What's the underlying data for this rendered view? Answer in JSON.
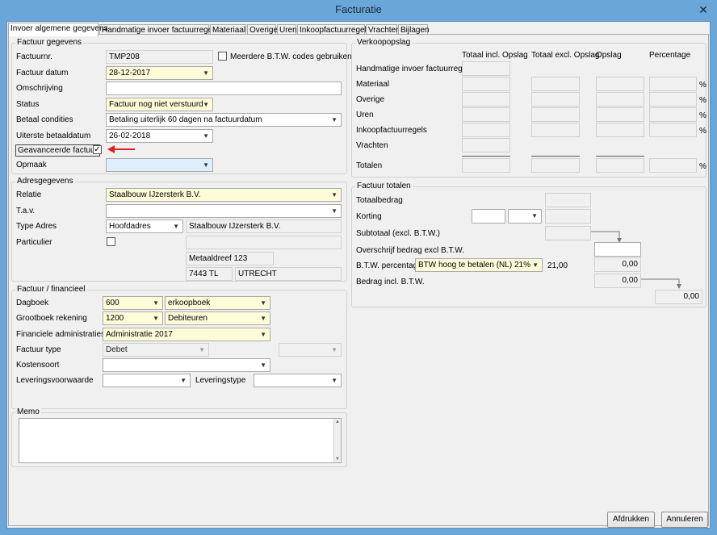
{
  "window": {
    "title": "Facturatie",
    "close_glyph": "✕"
  },
  "tabs": [
    "Invoer algemene gegevens",
    "Handmatige invoer factuurregels",
    "Materiaal",
    "Overige",
    "Uren",
    "Inkoopfactuurregels",
    "Vrachten",
    "Bijlagen"
  ],
  "factuur": {
    "group_title": "Factuur gegevens",
    "factuurnr_label": "Factuurnr.",
    "factuurnr": "TMP208",
    "btw_codes_label": "Meerdere B.T.W. codes gebruiken",
    "datum_label": "Factuur datum",
    "datum": "28-12-2017",
    "omschrijving_label": "Omschrijving",
    "omschrijving": "",
    "status_label": "Status",
    "status": "Factuur nog niet verstuurd",
    "betaal_label": "Betaal condities",
    "betaal": "Betaling uiterlijk 60 dagen na factuurdatum",
    "uiterste_label": "Uiterste betaaldatum",
    "uiterste": "26-02-2018",
    "geavanceerd_label": "Geavanceerde factuur",
    "geavanceerd_check": "✓",
    "opmaak_label": "Opmaak",
    "opmaak": ""
  },
  "adres": {
    "group_title": "Adresgegevens",
    "relatie_label": "Relatie",
    "relatie": "Staalbouw IJzersterk B.V.",
    "tav_label": "T.a.v.",
    "tav": "",
    "type_label": "Type Adres",
    "type": "Hoofdadres",
    "naam": "Staalbouw IJzersterk B.V.",
    "particulier_label": "Particulier",
    "straat": "Metaaldreef 123",
    "postcode": "7443 TL",
    "plaats": "UTRECHT"
  },
  "financieel": {
    "group_title": "Factuur / financieel",
    "dagboek_label": "Dagboek",
    "dagboek_code": "600",
    "dagboek_naam": "erkoopboek",
    "grootboek_label": "Grootboek rekening",
    "grootboek_code": "1200",
    "grootboek_naam": "Debiteuren",
    "admin_label": "Financiele administraties",
    "admin": "Administratie 2017",
    "type_label": "Factuur type",
    "type": "Debet",
    "kostensoort_label": "Kostensoort",
    "leverings_label": "Leveringsvoorwaarde",
    "leveringstype_label": "Leveringstype"
  },
  "memo": {
    "group_title": "Memo",
    "text": ""
  },
  "verkoop": {
    "group_title": "Verkoopopslag",
    "headers": [
      "Totaal incl. Opslag",
      "Totaal excl. Opslag",
      "Opslag",
      "Percentage"
    ],
    "rows": [
      "Handmatige invoer factuurregels",
      "Materiaal",
      "Overige",
      "Uren",
      "Inkoopfactuurregels",
      "Vrachten",
      "Totalen"
    ],
    "pct_symbol": "%"
  },
  "totalen": {
    "group_title": "Factuur totalen",
    "totaalbedrag_label": "Totaalbedrag",
    "korting_label": "Korting",
    "subtotaal_label": "Subtotaal (excl. B.T.W.)",
    "overschrijf_label": "Overschrijf bedrag excl B.T.W.",
    "btw_label": "B.T.W. percentage",
    "btw_value": "BTW hoog te betalen (NL) 21%",
    "btw_rate": "21,00",
    "btw_amount": "0,00",
    "incl_label": "Bedrag incl. B.T.W.",
    "incl_amount": "0,00",
    "final_amount": "0,00"
  },
  "buttons": {
    "print": "Afdrukken",
    "cancel": "Annuleren"
  },
  "colors": {
    "required": "#fefbd8",
    "highlight": "#dfeefc",
    "annotation_arrow": "#e0201b"
  }
}
